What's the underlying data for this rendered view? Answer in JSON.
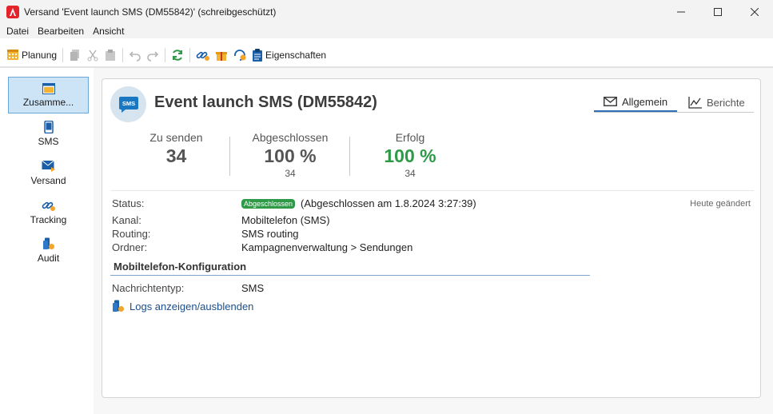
{
  "window": {
    "title": "Versand 'Event launch SMS (DM55842)' (schreibgeschützt)"
  },
  "menu": [
    "Datei",
    "Bearbeiten",
    "Ansicht"
  ],
  "toolbar": {
    "planung_label": "Planung",
    "properties_label": "Eigenschaften"
  },
  "nav": {
    "items": [
      {
        "label": "Zusamme...",
        "icon": "summary-icon",
        "active": true
      },
      {
        "label": "SMS",
        "icon": "phone-icon"
      },
      {
        "label": "Versand",
        "icon": "delivery-icon"
      },
      {
        "label": "Tracking",
        "icon": "tracking-icon"
      },
      {
        "label": "Audit",
        "icon": "audit-icon"
      }
    ]
  },
  "header": {
    "title": "Event launch SMS (DM55842)",
    "icon_text": "SMS",
    "tabs": [
      {
        "label": "Allgemein",
        "icon": "envelope-icon",
        "active": true
      },
      {
        "label": "Berichte",
        "icon": "line-chart-icon"
      }
    ]
  },
  "stats": [
    {
      "label": "Zu senden",
      "value": "34",
      "sub": ""
    },
    {
      "label": "Abgeschlossen",
      "value": "100 %",
      "sub": "34"
    },
    {
      "label": "Erfolg",
      "value": "100 %",
      "sub": "34"
    }
  ],
  "details": {
    "status_label": "Status:",
    "status_badge": "Abgeschlossen",
    "status_text": "(Abgeschlossen am 1.8.2024 3:27:39)",
    "modified": "Heute geändert",
    "channel_label": "Kanal:",
    "channel_value": "Mobiltelefon (SMS)",
    "routing_label": "Routing:",
    "routing_value": "SMS routing",
    "folder_label": "Ordner:",
    "folder_value": "Kampagnenverwaltung > Sendungen"
  },
  "mobile_config": {
    "section_title": "Mobiltelefon-Konfiguration",
    "message_type_label": "Nachrichtentyp:",
    "message_type_value": "SMS"
  },
  "logs_link": "Logs anzeigen/ausblenden",
  "colors": {
    "success": "#2e9a48",
    "accent": "#2e6fb5",
    "nav_active": "#cde4f7"
  }
}
